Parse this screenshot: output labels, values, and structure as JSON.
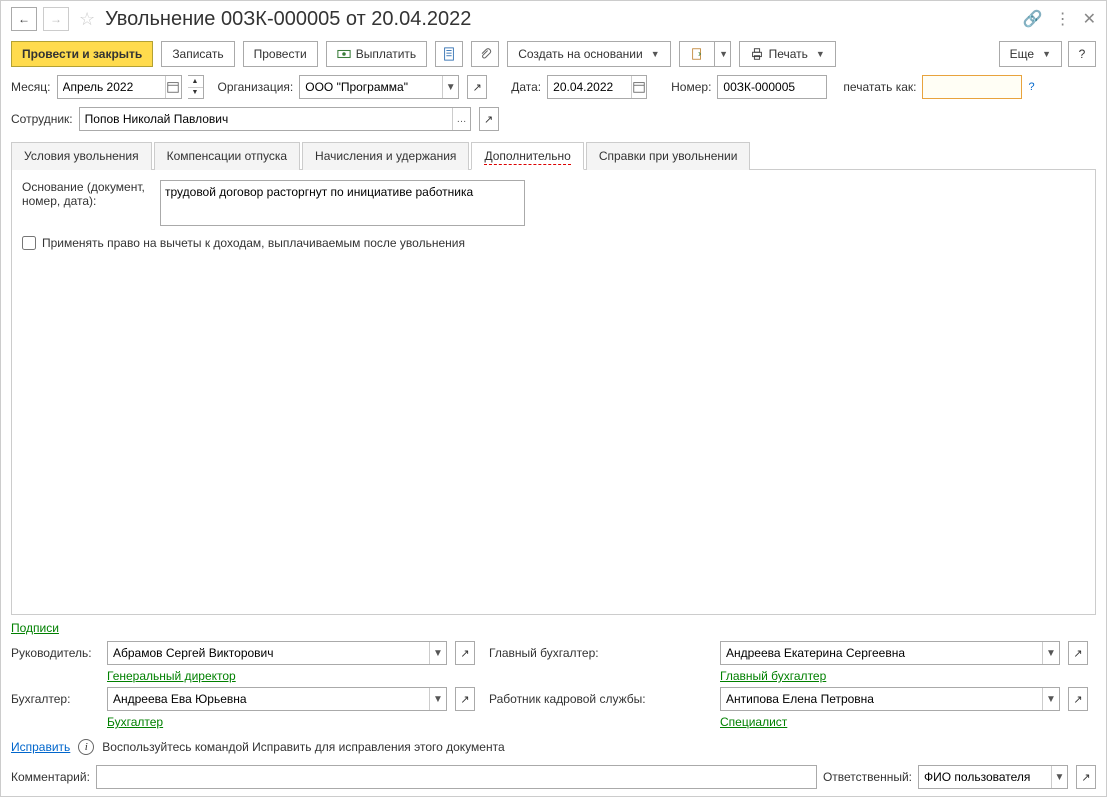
{
  "title": "Увольнение 00ЗК-000005 от 20.04.2022",
  "toolbar": {
    "post_close": "Провести и закрыть",
    "write": "Записать",
    "post": "Провести",
    "pay": "Выплатить",
    "create_based": "Создать на основании",
    "print": "Печать",
    "more": "Еще",
    "help": "?"
  },
  "header": {
    "month_lbl": "Месяц:",
    "month_val": "Апрель 2022",
    "org_lbl": "Организация:",
    "org_val": "ООО \"Программа\"",
    "date_lbl": "Дата:",
    "date_val": "20.04.2022",
    "num_lbl": "Номер:",
    "num_val": "00ЗК-000005",
    "print_as_lbl": "печатать как:",
    "print_as_val": "",
    "emp_lbl": "Сотрудник:",
    "emp_val": "Попов Николай Павлович"
  },
  "tabs": {
    "t1": "Условия увольнения",
    "t2": "Компенсации отпуска",
    "t3": "Начисления и удержания",
    "t4": "Дополнительно",
    "t5": "Справки при увольнении"
  },
  "extra": {
    "osnov_lbl": "Основание (документ, номер, дата):",
    "osnov_val": "трудовой договор расторгнут по инициативе работника",
    "chk_lbl": "Применять право на вычеты к доходам, выплачиваемым после увольнения"
  },
  "sig": {
    "section": "Подписи",
    "head_lbl": "Руководитель:",
    "head_val": "Абрамов Сергей Викторович",
    "head_pos": "Генеральный директор",
    "chief_acc_lbl": "Главный бухгалтер:",
    "chief_acc_val": "Андреева Екатерина Сергеевна",
    "chief_acc_pos": "Главный бухгалтер",
    "acc_lbl": "Бухгалтер:",
    "acc_val": "Андреева Ева Юрьевна",
    "acc_pos": "Бухгалтер",
    "hr_lbl": "Работник кадровой службы:",
    "hr_val": "Антипова Елена Петровна",
    "hr_pos": "Специалист"
  },
  "fix": {
    "link": "Исправить",
    "hint": "Воспользуйтесь командой Исправить для исправления этого документа"
  },
  "bottom": {
    "comment_lbl": "Комментарий:",
    "comment_val": "",
    "resp_lbl": "Ответственный:",
    "resp_val": "ФИО пользователя"
  }
}
